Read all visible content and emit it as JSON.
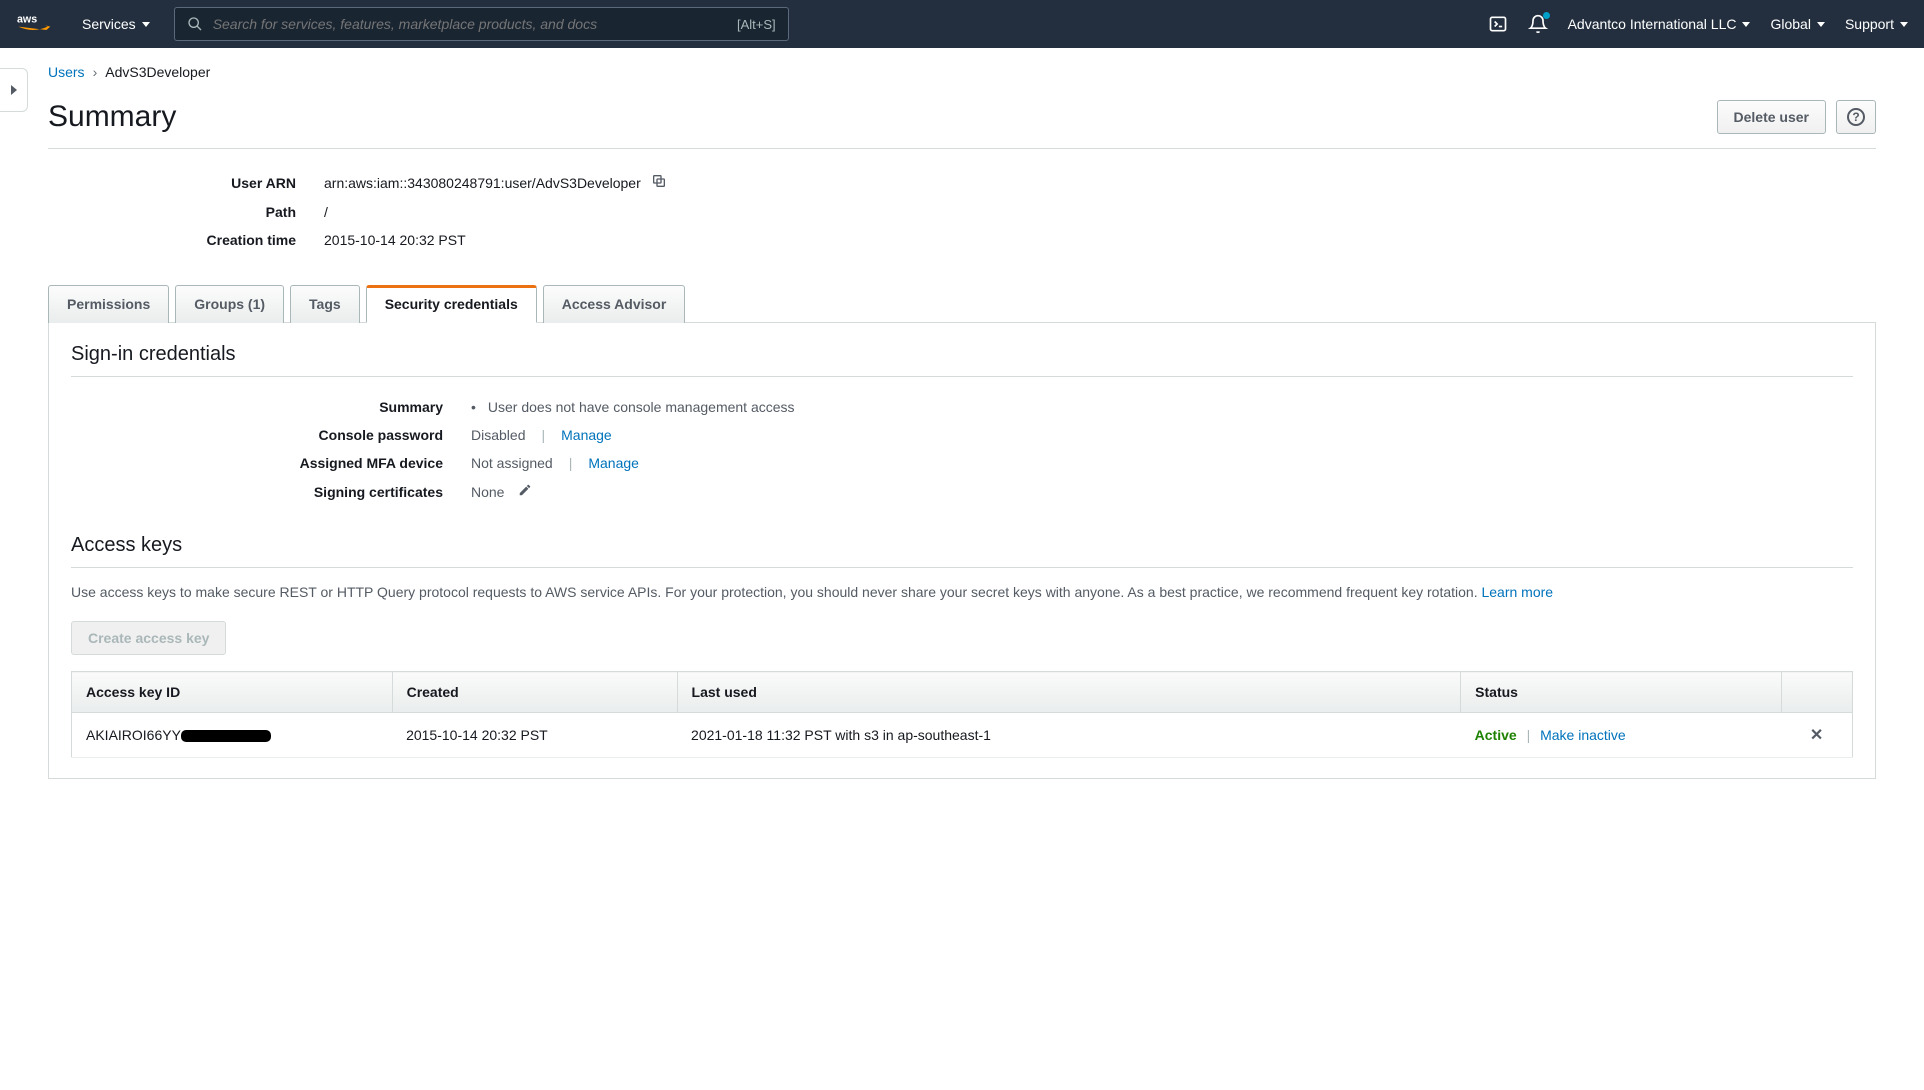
{
  "nav": {
    "services": "Services",
    "search_placeholder": "Search for services, features, marketplace products, and docs",
    "search_hint": "[Alt+S]",
    "account": "Advantco International LLC",
    "region": "Global",
    "support": "Support"
  },
  "breadcrumb": {
    "parent": "Users",
    "current": "AdvS3Developer"
  },
  "header": {
    "title": "Summary",
    "delete_btn": "Delete user"
  },
  "summary": {
    "arn_label": "User ARN",
    "arn_value": "arn:aws:iam::343080248791:user/AdvS3Developer",
    "path_label": "Path",
    "path_value": "/",
    "created_label": "Creation time",
    "created_value": "2015-10-14 20:32 PST"
  },
  "tabs": {
    "permissions": "Permissions",
    "groups": "Groups (1)",
    "tags": "Tags",
    "security": "Security credentials",
    "advisor": "Access Advisor"
  },
  "signin": {
    "heading": "Sign-in credentials",
    "summary_label": "Summary",
    "summary_bullet": "User does not have console management access",
    "console_pw_label": "Console password",
    "console_pw_value": "Disabled",
    "manage": "Manage",
    "mfa_label": "Assigned MFA device",
    "mfa_value": "Not assigned",
    "cert_label": "Signing certificates",
    "cert_value": "None"
  },
  "access_keys": {
    "heading": "Access keys",
    "desc": "Use access keys to make secure REST or HTTP Query protocol requests to AWS service APIs. For your protection, you should never share your secret keys with anyone. As a best practice, we recommend frequent key rotation. ",
    "learn_more": "Learn more",
    "create_btn": "Create access key",
    "cols": {
      "id": "Access key ID",
      "created": "Created",
      "last_used": "Last used",
      "status": "Status"
    },
    "row": {
      "id_visible": "AKIAIROI66YY",
      "created": "2015-10-14 20:32 PST",
      "last_used": "2021-01-18 11:32 PST with s3 in ap-southeast-1",
      "status": "Active",
      "make_inactive": "Make inactive"
    }
  }
}
